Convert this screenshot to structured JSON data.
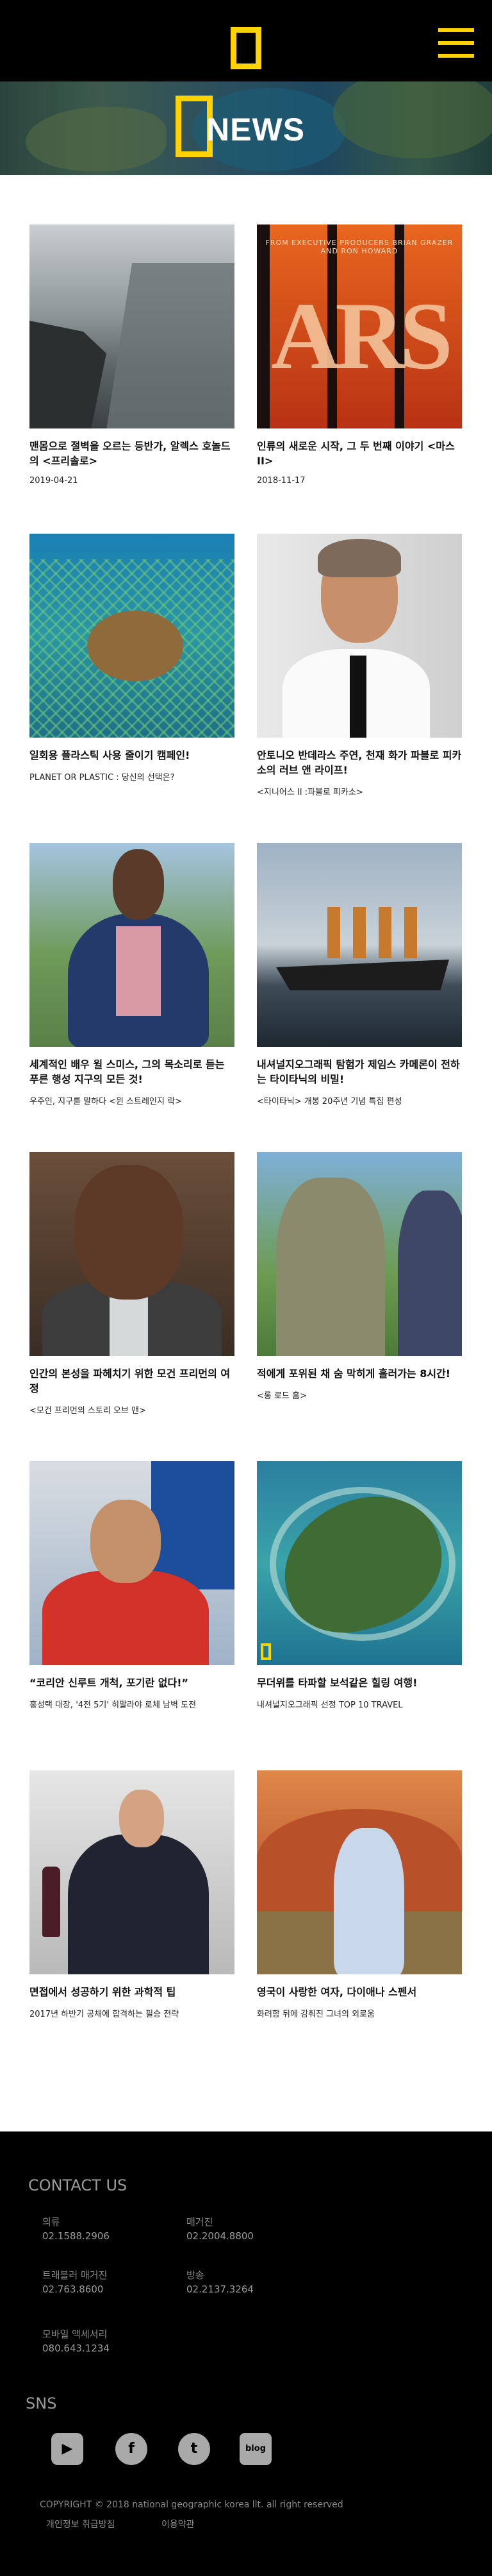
{
  "header": {
    "logo_icon": "national-geographic-logo-icon",
    "menu_icon": "hamburger-menu-icon",
    "accent": "#ffd200"
  },
  "banner": {
    "title": "NEWS"
  },
  "articles": [
    {
      "title": "맨몸으로 절벽을 오르는 등반가, 알렉스 호놀드의 <프리솔로>",
      "sub": "2019-04-21"
    },
    {
      "title": "인류의 새로운 시작, 그 두 번째 이야기 <마스 II>",
      "sub": "2018-11-17",
      "poster_caption": "FROM EXECUTIVE PRODUCERS BRIAN GRAZER AND RON HOWARD",
      "poster_text": "ARS"
    },
    {
      "title": "일회용 플라스틱 사용 줄이기 캠페인!",
      "sub": "PLANET OR PLASTIC : 당신의 선택은?"
    },
    {
      "title": "안토니오 반데라스 주연, 천재 화가 파블로 피카소의 러브 앤 라이프!",
      "sub": "<지니어스 II :파블로 피카소>"
    },
    {
      "title": "세계적인 배우 윌 스미스, 그의 목소리로 듣는 푸른 행성 지구의 모든 것!",
      "sub": "우주인, 지구를 말하다 <윈 스트레인지 락>"
    },
    {
      "title": "내셔널지오그래픽 탐험가 제임스 카메론이 전하는 타이타닉의 비밀!",
      "sub": "<타이타닉> 개봉 20주년 기념 특집 편성"
    },
    {
      "title": "인간의 본성을 파헤치기 위한 모건 프리먼의 여정",
      "sub": "<모건 프리먼의 스토리 오브 맨>"
    },
    {
      "title": "적에게 포위된 채 숨 막히게 흘러가는 8시간!",
      "sub": "<롱 로드 홈>"
    },
    {
      "title": "“코리안 신루트 개척, 포기란 없다!”",
      "sub": "홍성택 대장, '4전 5기' 히말라야 로체 남벽 도전"
    },
    {
      "title": "무더위를 타파할 보석같은 힐링 여행!",
      "sub": "내셔널지오그래픽 선정 TOP 10 TRAVEL",
      "badge": "NATIONAL GEOGRAPHIC"
    },
    {
      "title": "면접에서 성공하기 위한 과학적 팁",
      "sub": "2017년 하반기 공채에 합격하는 필승 전략"
    },
    {
      "title": "영국이 사랑한 여자, 다이애나 스펜서",
      "sub": "화려함 뒤에 감춰진 그녀의 외로움"
    }
  ],
  "footer": {
    "contact_title": "CONTACT US",
    "contacts": [
      {
        "label": "의류",
        "value": "02.1588.2906"
      },
      {
        "label": "매거진",
        "value": "02.2004.8800"
      },
      {
        "label": "트래블러 매거진",
        "value": "02.763.8600"
      },
      {
        "label": "방송",
        "value": "02.2137.3264"
      },
      {
        "label": "모바일 액세서리",
        "value": "080.643.1234"
      }
    ],
    "sns_title": "SNS",
    "sns": [
      {
        "name": "youtube-icon",
        "glyph": "▶"
      },
      {
        "name": "facebook-icon",
        "glyph": "f"
      },
      {
        "name": "twitter-icon",
        "glyph": "t"
      },
      {
        "name": "blog-icon",
        "glyph": "blog"
      }
    ],
    "copyright": "COPYRIGHT © 2018 national geographic korea llt.  all right reserved",
    "links": [
      "개인정보 취급방침",
      "이용약관"
    ]
  }
}
